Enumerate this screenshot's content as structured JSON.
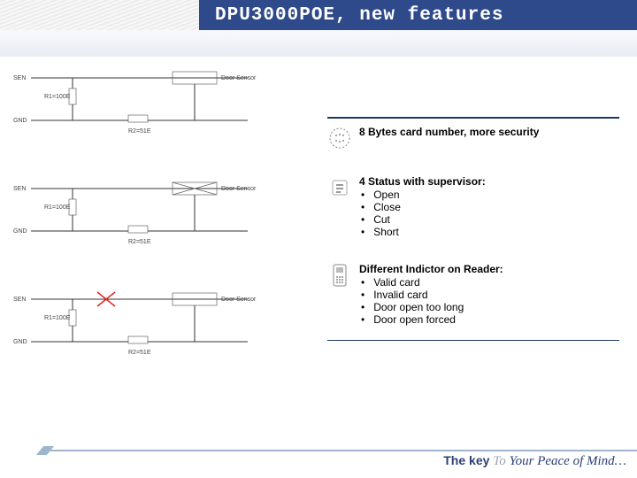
{
  "header": {
    "title": "DPU3000POE, new features"
  },
  "features": [
    {
      "title": "8 Bytes card number, more security",
      "items": []
    },
    {
      "title": "4 Status with supervisor:",
      "items": [
        "Open",
        "Close",
        "Cut",
        "Short"
      ]
    },
    {
      "title": "Different Indictor on Reader:",
      "items": [
        "Valid card",
        "Invalid card",
        "Door open too long",
        "Door open forced"
      ]
    }
  ],
  "diagram": {
    "labels": {
      "sen": "SEN",
      "gnd": "GND",
      "r1_100e": "R1=100E",
      "r2_51e": "R2=51E",
      "door_sensor": "Door Sensor"
    }
  },
  "footer": {
    "tagline_key": "The key",
    "tagline_to": "To",
    "tagline_rest": "Your Peace of Mind…"
  }
}
